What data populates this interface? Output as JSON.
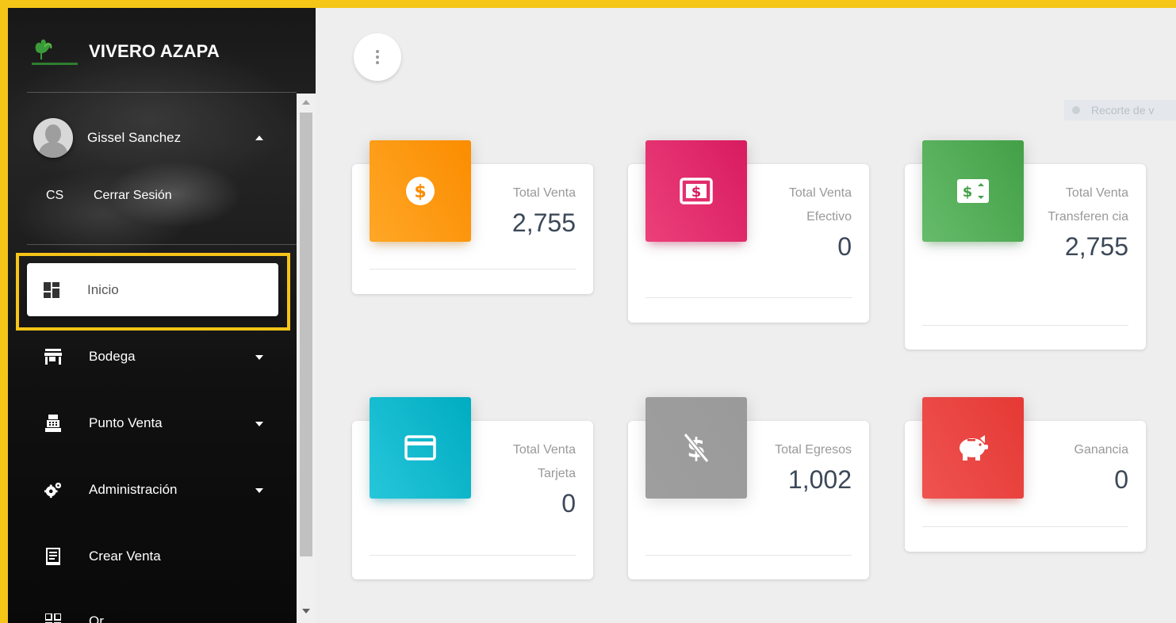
{
  "brand": {
    "title": "VIVERO AZAPA",
    "logo_icon": "plant-logo-icon"
  },
  "user": {
    "name": "Gissel Sanchez",
    "logout_abbr": "CS",
    "logout_label": "Cerrar Sesión"
  },
  "sidebar": {
    "items": [
      {
        "label": "Inicio",
        "icon": "dashboard-icon",
        "active": true
      },
      {
        "label": "Bodega",
        "icon": "store-icon",
        "dropdown": true
      },
      {
        "label": "Punto Venta",
        "icon": "cash-register-icon",
        "dropdown": true
      },
      {
        "label": "Administración",
        "icon": "settings-gears-icon",
        "dropdown": true
      },
      {
        "label": "Crear Venta",
        "icon": "receipt-icon"
      },
      {
        "label": "Qr",
        "icon": "qr-code-icon"
      }
    ]
  },
  "header": {
    "menu_icon": "more-vert-icon"
  },
  "recorte": {
    "label": "Recorte de v"
  },
  "cards": [
    {
      "category": "Total Venta",
      "value": "2,755",
      "icon": "dollar-circle-icon",
      "color": "#fb8c00"
    },
    {
      "category": "Total Venta Efectivo",
      "value": "0",
      "icon": "cash-icon",
      "color": "#d81b60"
    },
    {
      "category": "Total Venta Transferen cia",
      "value": "2,755",
      "icon": "transfer-money-icon",
      "color": "#43a047"
    },
    {
      "category": "Total Venta Tarjeta",
      "value": "0",
      "icon": "credit-card-icon",
      "color": "#00acc1"
    },
    {
      "category": "Total Egresos",
      "value": "1,002",
      "icon": "money-off-icon",
      "color": "#9e9e9e"
    },
    {
      "category": "Ganancia",
      "value": "0",
      "icon": "piggy-bank-icon",
      "color": "#e53935"
    }
  ],
  "colors": {
    "highlight": "#f5c518",
    "main_bg": "#eeeeee"
  }
}
